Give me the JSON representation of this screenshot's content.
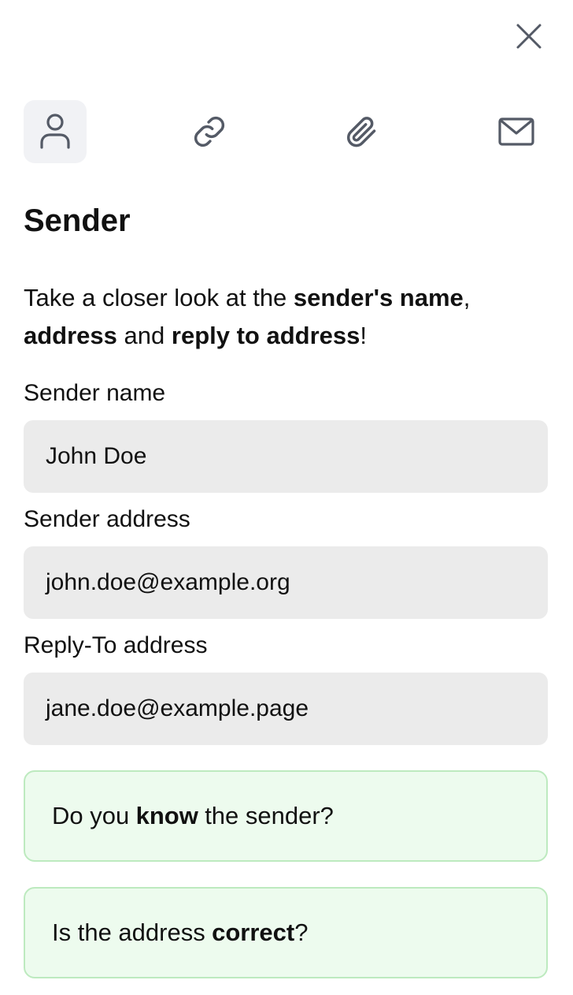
{
  "title": "Sender",
  "intro": {
    "t1": "Take a closer look at the",
    "b1": "sender's name",
    "t2": ",",
    "b2": "address",
    "t3": "and",
    "b3": "reply to address",
    "t4": "!"
  },
  "tabs": [
    {
      "icon": "user-icon",
      "active": true
    },
    {
      "icon": "link-icon",
      "active": false
    },
    {
      "icon": "paperclip-icon",
      "active": false
    },
    {
      "icon": "mail-icon",
      "active": false
    }
  ],
  "fields": {
    "sender_name": {
      "label": "Sender name",
      "value": "John Doe"
    },
    "sender_address": {
      "label": "Sender address",
      "value": "john.doe@example.org"
    },
    "reply_to": {
      "label": "Reply-To address",
      "value": "jane.doe@example.page"
    }
  },
  "questions": {
    "q1": {
      "pre": "Do you",
      "bold": "know",
      "post": "the sender?"
    },
    "q2": {
      "pre": "Is the address",
      "bold": "correct",
      "post": "?"
    }
  },
  "colors": {
    "icon": "#545a66",
    "active_tab_bg": "#f1f2f5",
    "field_bg": "#ebebeb",
    "card_bg": "#edfbee",
    "card_border": "#bdeabf"
  }
}
